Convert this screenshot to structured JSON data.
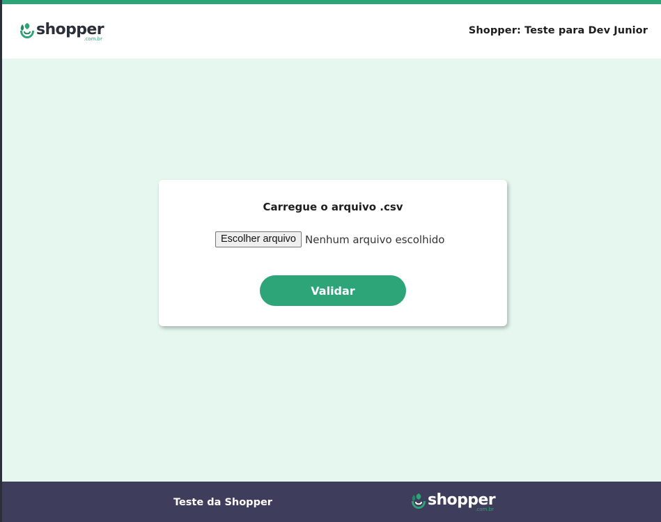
{
  "header": {
    "logo_brand": "shopper",
    "logo_domain": ".com.br",
    "title": "Shopper: Teste para Dev Junior"
  },
  "upload_card": {
    "title": "Carregue o arquivo .csv",
    "file_button_label": "Escolher arquivo",
    "file_status": "Nenhum arquivo escolhido",
    "validate_label": "Validar"
  },
  "footer": {
    "text": "Teste da Shopper",
    "logo_brand": "shopper",
    "logo_domain": ".com.br"
  },
  "colors": {
    "accent": "#2da578",
    "background": "#e6f7f0",
    "footer": "#3e3d5c",
    "text_dark": "#1d1d1d"
  },
  "icons": {
    "logo_mark": "shopper-leaf-bag-logo"
  }
}
